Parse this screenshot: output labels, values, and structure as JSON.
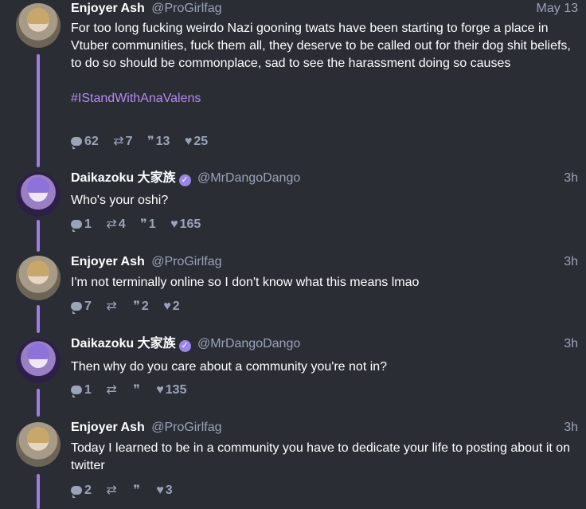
{
  "tweets": [
    {
      "name": "Enjoyer Ash",
      "handle": "@ProGirlfag",
      "time": "May 13",
      "verified": false,
      "text": "For too long fucking weirdo Nazi gooning twats have been starting to forge a place in Vtuber communities, fuck them all, they deserve to be called out for their dog shit beliefs, to do so should be commonplace, sad to see the harassment doing so causes",
      "hashtag": "#IStandWithAnaValens",
      "stats": {
        "replies": "62",
        "reposts": "7",
        "quotes": "13",
        "likes": "25"
      }
    },
    {
      "name": "Daikazoku 大家族",
      "handle": "@MrDangoDango",
      "time": "3h",
      "verified": true,
      "text": "Who's your oshi?",
      "stats": {
        "replies": "1",
        "reposts": "4",
        "quotes": "1",
        "likes": "165"
      }
    },
    {
      "name": "Enjoyer Ash",
      "handle": "@ProGirlfag",
      "time": "3h",
      "verified": false,
      "text": "I'm not terminally online so I don't know what this means lmao",
      "stats": {
        "replies": "7",
        "reposts": "",
        "quotes": "2",
        "likes": "2"
      }
    },
    {
      "name": "Daikazoku 大家族",
      "handle": "@MrDangoDango",
      "time": "3h",
      "verified": true,
      "text": "Then why do you care about a community you're not in?",
      "stats": {
        "replies": "1",
        "reposts": "",
        "quotes": "",
        "likes": "135"
      }
    },
    {
      "name": "Enjoyer Ash",
      "handle": "@ProGirlfag",
      "time": "3h",
      "verified": false,
      "text": "Today I learned to be in a community you have to dedicate your life to posting about it on twitter",
      "stats": {
        "replies": "2",
        "reposts": "",
        "quotes": "",
        "likes": "3"
      }
    }
  ],
  "icons": {
    "reply": "speech-bubble-icon",
    "repost": "repost-arrows-icon",
    "quote": "quote-marks-icon",
    "like": "heart-icon",
    "verified": "check-badge-icon"
  },
  "colors": {
    "background": "#2b2d35",
    "thread_line": "#a07be6",
    "hashtag": "#b48bf2",
    "muted": "#9aa3b8",
    "verified": "#9a86e6"
  }
}
